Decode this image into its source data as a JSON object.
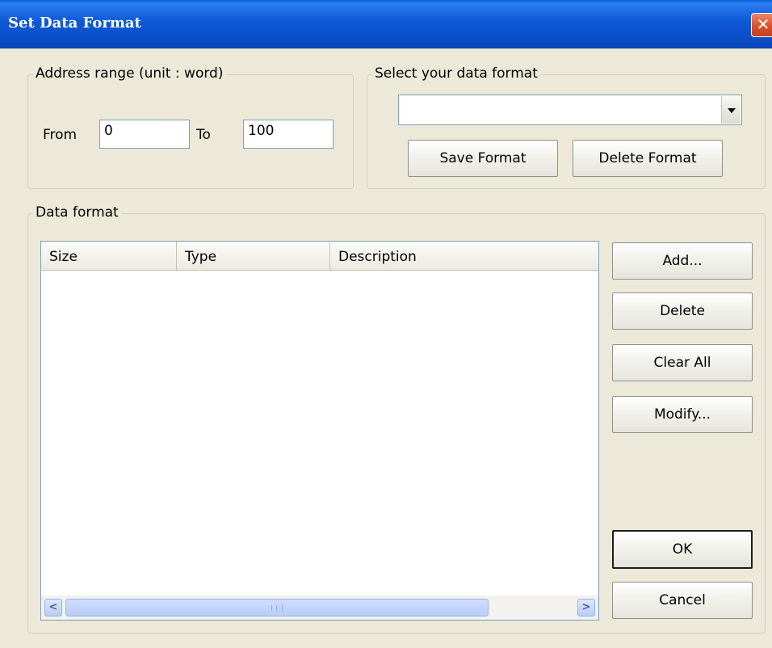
{
  "window": {
    "title": "Set Data Format",
    "close_glyph": "✕"
  },
  "address_range": {
    "legend": "Address range (unit : word)",
    "from_label": "From",
    "from_value": "0",
    "to_label": "To",
    "to_value": "100"
  },
  "data_format_select": {
    "legend": "Select your data format",
    "selected": "",
    "save_button": "Save Format",
    "delete_button": "Delete Format"
  },
  "data_format": {
    "legend": "Data format",
    "columns": [
      "Size",
      "Type",
      "Description"
    ],
    "rows": []
  },
  "buttons": {
    "add": "Add...",
    "delete": "Delete",
    "clear_all": "Clear All",
    "modify": "Modify...",
    "ok": "OK",
    "cancel": "Cancel"
  },
  "scrollbar": {
    "left_arrow": "<",
    "right_arrow": ">",
    "left_icon": "chevron-left-icon",
    "right_icon": "chevron-right-icon"
  },
  "colors": {
    "dialog_background": "#ece9d8",
    "titlebar_blue": "#0a5fd8",
    "close_red": "#d8522f"
  }
}
